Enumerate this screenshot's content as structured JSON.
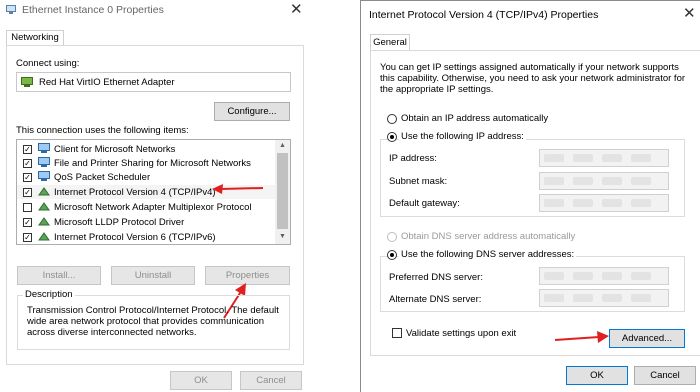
{
  "left": {
    "title": "Ethernet Instance 0 Properties",
    "tab": "Networking",
    "connect_using_label": "Connect using:",
    "adapter_name": "Red Hat VirtIO Ethernet Adapter",
    "configure_button": "Configure...",
    "items_label": "This connection uses the following items:",
    "items": [
      {
        "label": "Client for Microsoft Networks",
        "checked": true
      },
      {
        "label": "File and Printer Sharing for Microsoft Networks",
        "checked": true
      },
      {
        "label": "QoS Packet Scheduler",
        "checked": true
      },
      {
        "label": "Internet Protocol Version 4 (TCP/IPv4)",
        "checked": true
      },
      {
        "label": "Microsoft Network Adapter Multiplexor Protocol",
        "checked": false
      },
      {
        "label": "Microsoft LLDP Protocol Driver",
        "checked": true
      },
      {
        "label": "Internet Protocol Version 6 (TCP/IPv6)",
        "checked": true
      }
    ],
    "install_button": "Install...",
    "uninstall_button": "Uninstall",
    "properties_button": "Properties",
    "description_label": "Description",
    "description_text": "Transmission Control Protocol/Internet Protocol. The default wide area network protocol that provides communication across diverse interconnected networks.",
    "ok_button": "OK",
    "cancel_button": "Cancel"
  },
  "right": {
    "title": "Internet Protocol Version 4 (TCP/IPv4) Properties",
    "tab": "General",
    "intro": "You can get IP settings assigned automatically if your network supports this capability. Otherwise, you need to ask your network administrator for the appropriate IP settings.",
    "obtain_ip_auto": "Obtain an IP address automatically",
    "use_following_ip": "Use the following IP address:",
    "ip_address_label": "IP address:",
    "subnet_mask_label": "Subnet mask:",
    "default_gateway_label": "Default gateway:",
    "obtain_dns_auto": "Obtain DNS server address automatically",
    "use_following_dns": "Use the following DNS server addresses:",
    "preferred_dns_label": "Preferred DNS server:",
    "alternate_dns_label": "Alternate DNS server:",
    "validate_label": "Validate settings upon exit",
    "advanced_button": "Advanced...",
    "ok_button": "OK",
    "cancel_button": "Cancel"
  },
  "colors": {
    "annotation_arrow": "#e02020",
    "focus_border": "#0078d7"
  }
}
